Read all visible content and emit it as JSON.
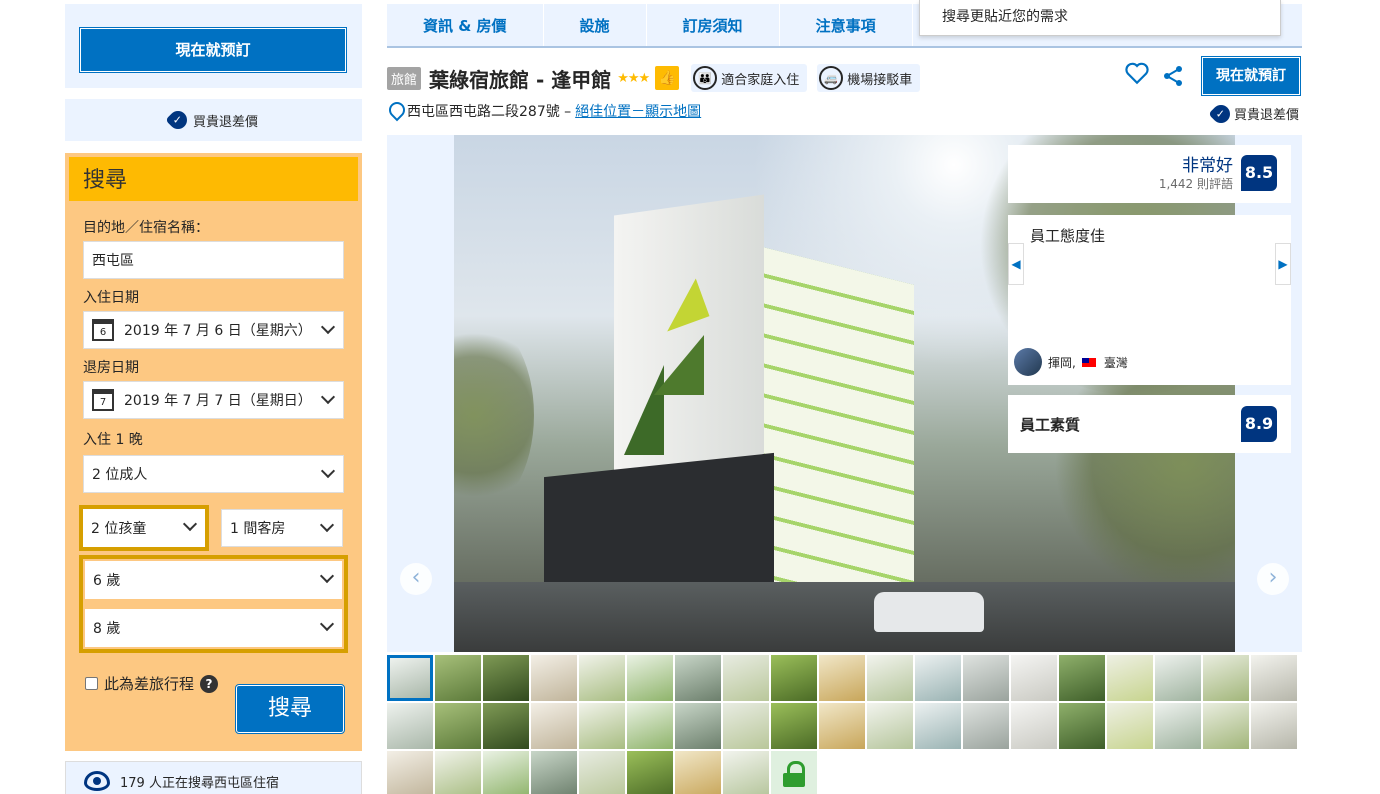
{
  "sidebar": {
    "book_now_label": "現在就预訂",
    "price_match": "買貴退差價",
    "search": {
      "title": "搜尋",
      "destination_label": "目的地／住宿名稱：",
      "destination_value": "西屯區",
      "checkin_label": "入住日期",
      "checkin_day": "6",
      "checkin_value": "2019 年 7 月 6 日（星期六）",
      "checkout_label": "退房日期",
      "checkout_day": "7",
      "checkout_value": "2019 年 7 月 7 日（星期日）",
      "nights_label": "入住 1 晚",
      "adults_value": "2 位成人",
      "children_value": "2 位孩童",
      "rooms_value": "1 間客房",
      "child_ages": [
        "6 歲",
        "8 歲"
      ],
      "business_trip_label": "此為差旅行程",
      "help_symbol": "?",
      "submit_label": "搜尋"
    },
    "viewers_text": "179 人正在搜尋西屯區住宿"
  },
  "tabs": [
    "資訊 & 房價",
    "設施",
    "訂房須知",
    "注意事項"
  ],
  "dropdown_tip": "搜尋更貼近您的需求",
  "hotel": {
    "type_badge": "旅館",
    "name": "葉綠宿旅館 - 逢甲館",
    "stars": "★★★",
    "chips": [
      "適合家庭入住",
      "機場接駁車"
    ],
    "book_now_label": "現在就預訂",
    "address": "西屯區西屯路二段287號 –",
    "map_link": "絕佳位置－顯示地圖",
    "price_match": "買貴退差價"
  },
  "review": {
    "label": "非常好",
    "count": "1,442 則評語",
    "score": "8.5",
    "quote": "員工態度佳",
    "reviewer_name": "揮岡,",
    "reviewer_country": "臺灣",
    "staff_label": "員工素質",
    "staff_score": "8.9"
  },
  "colors": {
    "brand_blue": "#0071c2",
    "dark_blue": "#003580",
    "search_yellow": "#feba02",
    "search_bg": "#fdc882",
    "child_border": "#d69f00"
  },
  "icons": [
    "check-shield-icon",
    "calendar-icon",
    "chevron-down-icon",
    "help-icon",
    "eye-icon",
    "pin-icon",
    "heart-icon",
    "share-icon",
    "thumbs-up-icon",
    "family-icon",
    "shuttle-icon",
    "lock-icon"
  ]
}
